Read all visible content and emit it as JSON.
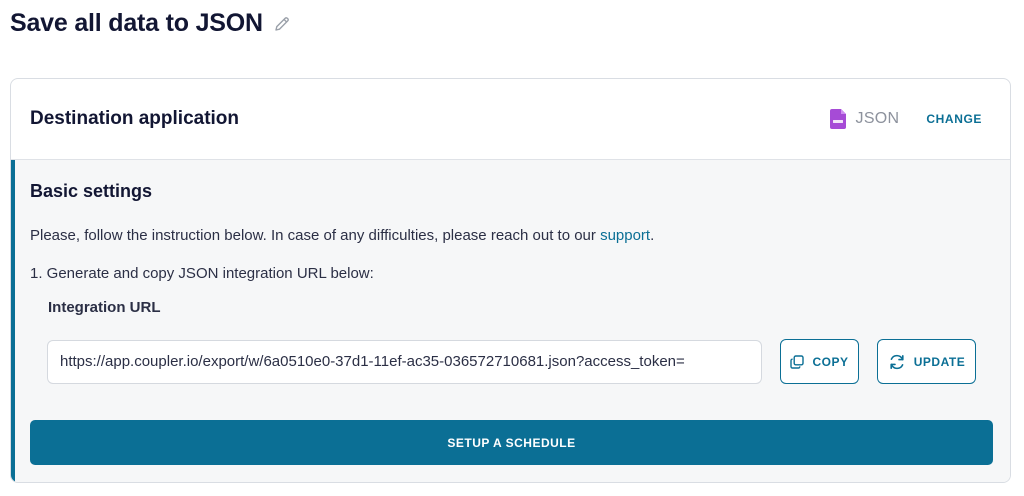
{
  "page": {
    "title": "Save all data to JSON",
    "edit_icon": "pencil-icon"
  },
  "destination": {
    "title": "Destination application",
    "app_icon": "json-file-icon",
    "app_name": "JSON",
    "change_label": "CHANGE"
  },
  "settings": {
    "title": "Basic settings",
    "instruction_text": "Please, follow the instruction below. In case of any difficulties, please reach out to our ",
    "support_link": "support",
    "instruction_end": ".",
    "step_1": "1. Generate and copy JSON integration URL below:",
    "url_label": "Integration URL",
    "url_value": "https://app.coupler.io/export/w/6a0510e0-37d1-11ef-ac35-036572710681.json?access_token=",
    "copy_label": "COPY",
    "copy_icon": "copy-icon",
    "update_label": "UPDATE",
    "update_icon": "refresh-icon",
    "schedule_label": "SETUP A SCHEDULE"
  },
  "colors": {
    "accent": "#0b6f95",
    "json_icon": "#a64bd6",
    "title": "#121633"
  }
}
